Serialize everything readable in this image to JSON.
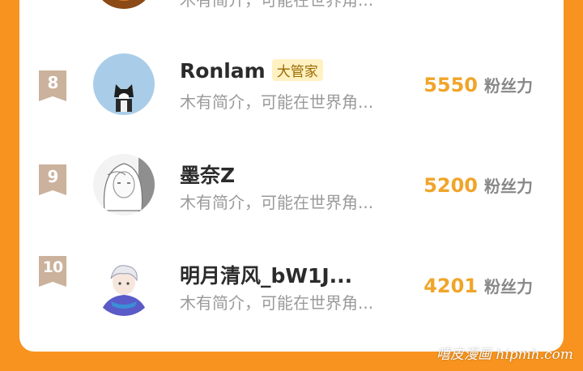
{
  "top_partial": {
    "bio": "木有简介，可能在世界角..."
  },
  "fans_label": "粉丝力",
  "rows": [
    {
      "rank": "8",
      "name": "Ronlam",
      "tag": "大管家",
      "bio": "木有简介，可能在世界角...",
      "fans": "5550"
    },
    {
      "rank": "9",
      "name": "墨奈Z",
      "bio": "木有简介，可能在世界角...",
      "fans": "5200"
    },
    {
      "rank": "10",
      "name": "明月清风_bW1J...",
      "bio": "木有简介，可能在世界角...",
      "fans": "4201"
    }
  ],
  "watermark": "嘻皮漫画 hipmh.com",
  "colors": {
    "accent_orange": "#f7931e",
    "fans_count": "#f0a52a",
    "rank_flag": "#cbb29c",
    "tag_bg": "#fff1c2"
  }
}
